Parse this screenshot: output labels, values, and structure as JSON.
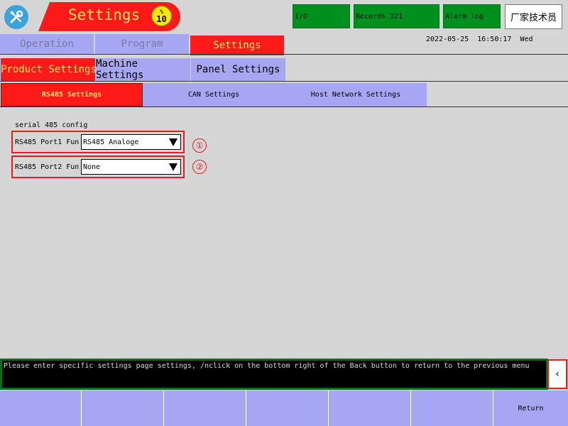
{
  "header": {
    "title": "Settings",
    "speed_badge": {
      "percent_symbol": "%",
      "value": "10"
    },
    "io_label": "I/O",
    "records_label": "Records 321",
    "alarm_label": "Alarm log",
    "user_label": "厂家技术员"
  },
  "main_nav": {
    "tabs": [
      {
        "label": "Operation",
        "active": false
      },
      {
        "label": "Program",
        "active": false
      },
      {
        "label": "Settings",
        "active": true
      }
    ],
    "datetime": "2022-05-25  16:50:17  Wed"
  },
  "sub_nav": {
    "tabs": [
      {
        "label": "Product Settings",
        "active": true
      },
      {
        "label": "Machine Settings",
        "active": false
      },
      {
        "label": "Panel Settings",
        "active": false
      }
    ]
  },
  "third_nav": {
    "tabs": [
      {
        "label": "RS485 Settings",
        "active": true
      },
      {
        "label": "CAN Settings",
        "active": false
      },
      {
        "label": "Host Network Settings",
        "active": false
      }
    ]
  },
  "content": {
    "section_label": "serial 485 config",
    "ports": [
      {
        "label": "RS485 Port1 Fun",
        "value": "RS485 Analoge",
        "marker": "①"
      },
      {
        "label": "RS485 Port2 Fun",
        "value": "None",
        "marker": "②"
      }
    ]
  },
  "message_bar": {
    "text": "Please enter specific settings page settings, /nclick on the bottom right of the Back button to return to the previous menu"
  },
  "back_button": {
    "label": "‹"
  },
  "bottom_bar": {
    "buttons": [
      "",
      "",
      "",
      "",
      "",
      "",
      "Return"
    ]
  },
  "colors": {
    "accent_red": "#ff1a1a",
    "tab_purple": "#a6a6f2",
    "status_green": "#00901e",
    "badge_yellow": "#ffe600"
  }
}
